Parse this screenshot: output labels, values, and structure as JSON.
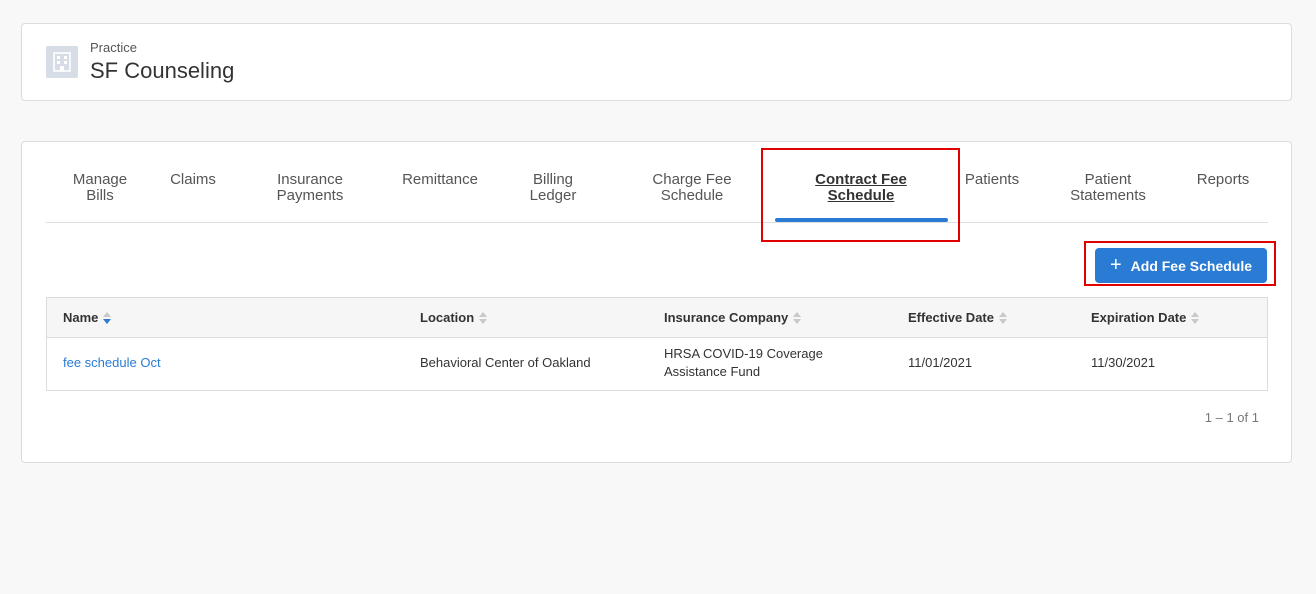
{
  "practice": {
    "label": "Practice",
    "name": "SF Counseling",
    "icon": "building-icon"
  },
  "tabs": [
    {
      "label": "Manage\nBills",
      "active": false
    },
    {
      "label": "Claims",
      "active": false
    },
    {
      "label": "Insurance\nPayments",
      "active": false
    },
    {
      "label": "Remittance",
      "active": false
    },
    {
      "label": "Billing\nLedger",
      "active": false
    },
    {
      "label": "Charge Fee\nSchedule",
      "active": false
    },
    {
      "label": "Contract Fee\nSchedule",
      "active": true
    },
    {
      "label": "Patients",
      "active": false
    },
    {
      "label": "Patient\nStatements",
      "active": false
    },
    {
      "label": "Reports",
      "active": false
    }
  ],
  "add_button": {
    "label": "Add Fee Schedule",
    "icon": "plus-icon"
  },
  "table": {
    "columns": [
      {
        "label": "Name",
        "sort": "desc"
      },
      {
        "label": "Location",
        "sort": "none"
      },
      {
        "label": "Insurance Company",
        "sort": "none"
      },
      {
        "label": "Effective Date",
        "sort": "none"
      },
      {
        "label": "Expiration Date",
        "sort": "none"
      }
    ],
    "rows": [
      {
        "name": "fee schedule Oct",
        "location": "Behavioral Center of Oakland",
        "insurance_company": "HRSA COVID-19 Coverage Assistance Fund",
        "effective_date": "11/01/2021",
        "expiration_date": "11/30/2021"
      }
    ]
  },
  "pagination": "1 – 1 of 1",
  "colors": {
    "accent": "#2a7bd4",
    "highlight": "#e00000"
  }
}
